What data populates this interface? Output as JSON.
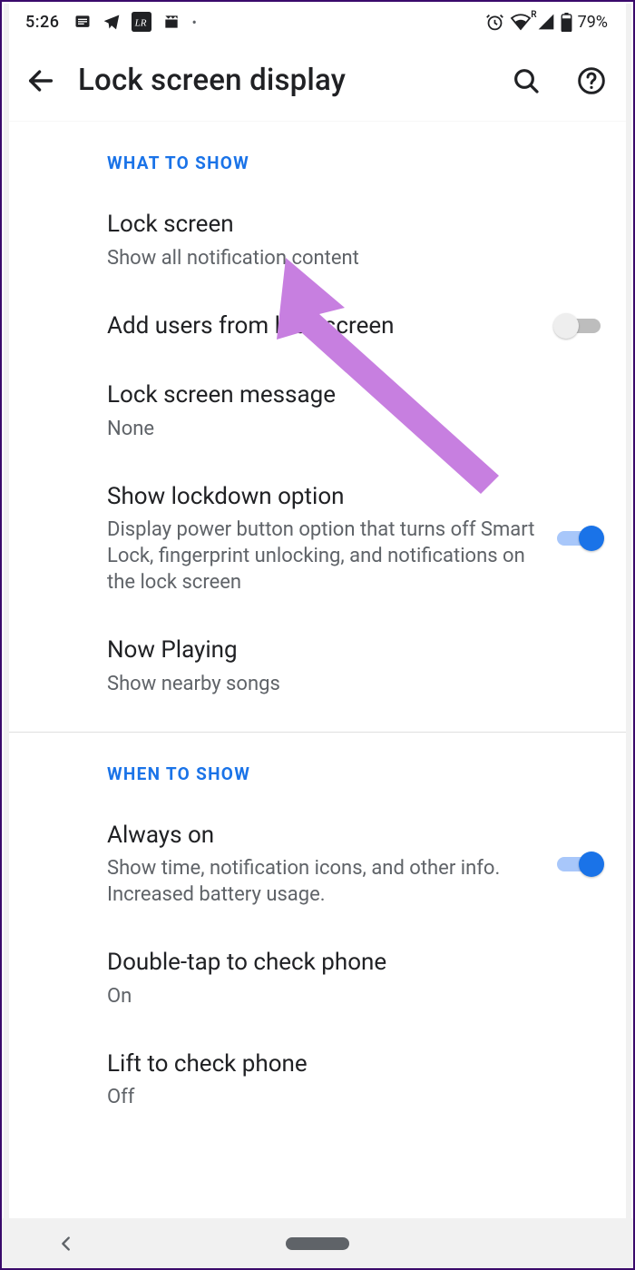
{
  "status": {
    "time": "5:26",
    "battery_pct": "79%",
    "roaming": "R"
  },
  "header": {
    "title": "Lock screen display"
  },
  "sections": [
    {
      "label": "WHAT TO SHOW",
      "items": [
        {
          "title": "Lock screen",
          "sub": "Show all notification content"
        },
        {
          "title": "Add users from lock screen",
          "toggle": "off"
        },
        {
          "title": "Lock screen message",
          "sub": "None"
        },
        {
          "title": "Show lockdown option",
          "sub": "Display power button option that turns off Smart Lock, fingerprint unlocking, and notifications on the lock screen",
          "toggle": "on"
        },
        {
          "title": "Now Playing",
          "sub": "Show nearby songs"
        }
      ]
    },
    {
      "label": "WHEN TO SHOW",
      "items": [
        {
          "title": "Always on",
          "sub": "Show time, notification icons, and other info. Increased battery usage.",
          "toggle": "on"
        },
        {
          "title": "Double-tap to check phone",
          "sub": "On"
        },
        {
          "title": "Lift to check phone",
          "sub": "Off"
        }
      ]
    }
  ]
}
